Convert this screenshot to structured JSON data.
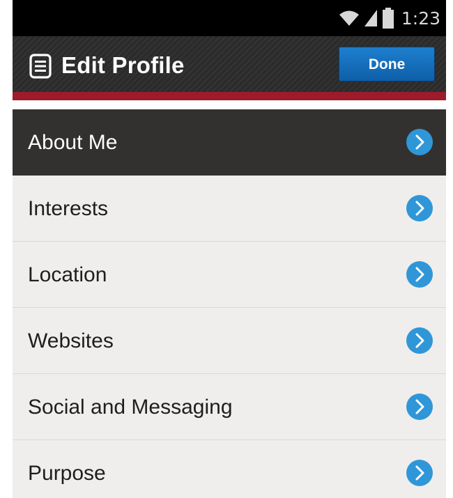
{
  "status_bar": {
    "time": "1:23",
    "icons": [
      "wifi-icon",
      "signal-icon",
      "battery-icon"
    ]
  },
  "header": {
    "title": "Edit Profile",
    "menu_icon": "menu-icon",
    "done_label": "Done"
  },
  "list": {
    "items": [
      {
        "label": "About Me",
        "selected": true
      },
      {
        "label": "Interests",
        "selected": false
      },
      {
        "label": "Location",
        "selected": false
      },
      {
        "label": "Websites",
        "selected": false
      },
      {
        "label": "Social and Messaging",
        "selected": false
      },
      {
        "label": "Purpose",
        "selected": false
      }
    ],
    "chevron_icon": "chevron-right-circle-icon"
  },
  "colors": {
    "accent_blue": "#2f97d8",
    "done_button": "#136bb8",
    "header_stripe": "#9c1c2b",
    "selected_row": "#333130",
    "list_background": "#efeeec"
  }
}
